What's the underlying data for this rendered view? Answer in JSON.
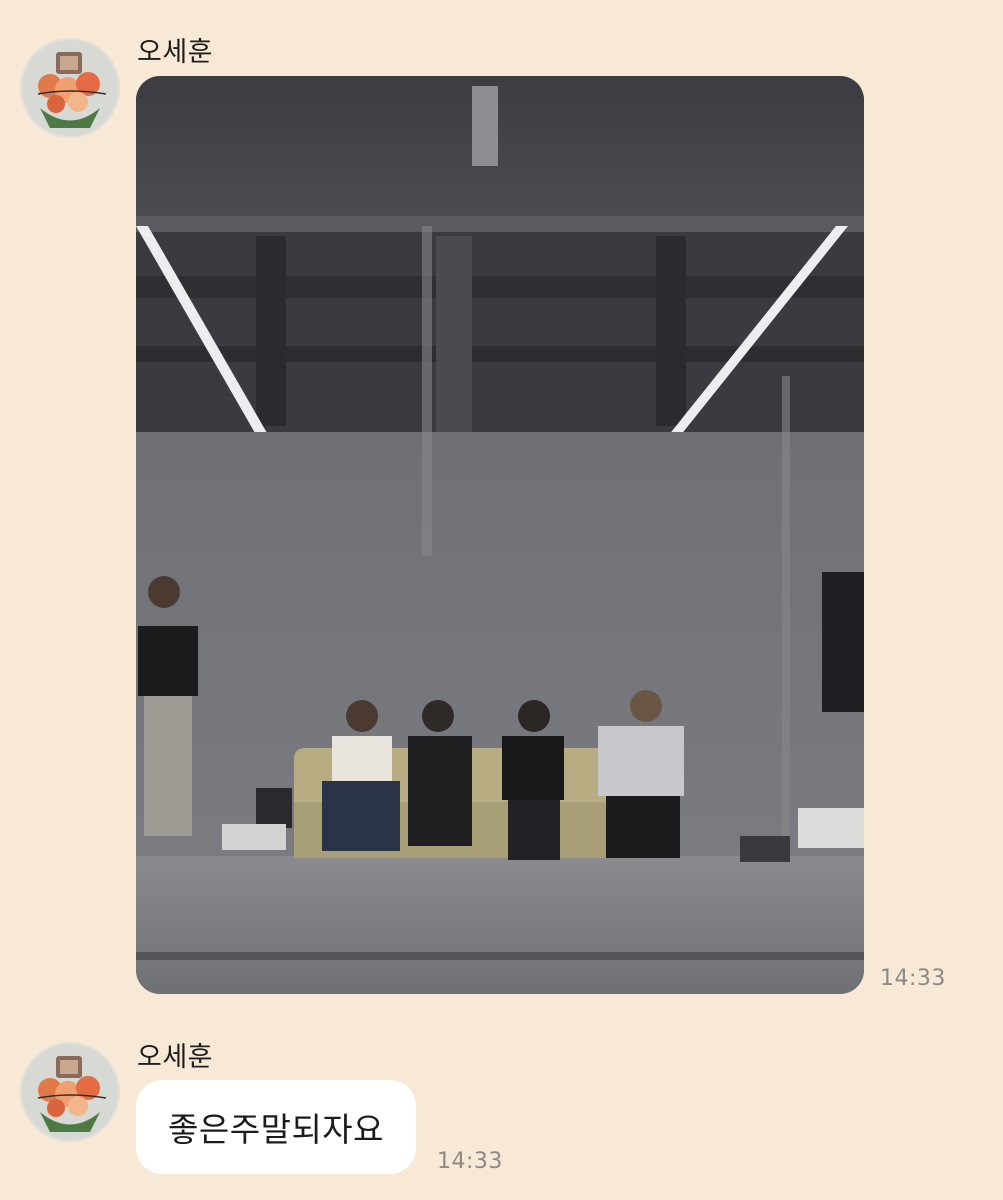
{
  "messages": [
    {
      "sender": "오세훈",
      "type": "photo",
      "time": "14:33"
    },
    {
      "sender": "오세훈",
      "type": "text",
      "text": "좋은주말되자요",
      "time": "14:33"
    }
  ],
  "icons": {
    "avatar": "profile-photo-bouquet"
  },
  "colors": {
    "chat_background": "#f7e9d5",
    "bubble_background": "#ffffff",
    "timestamp": "#8c8a86"
  }
}
